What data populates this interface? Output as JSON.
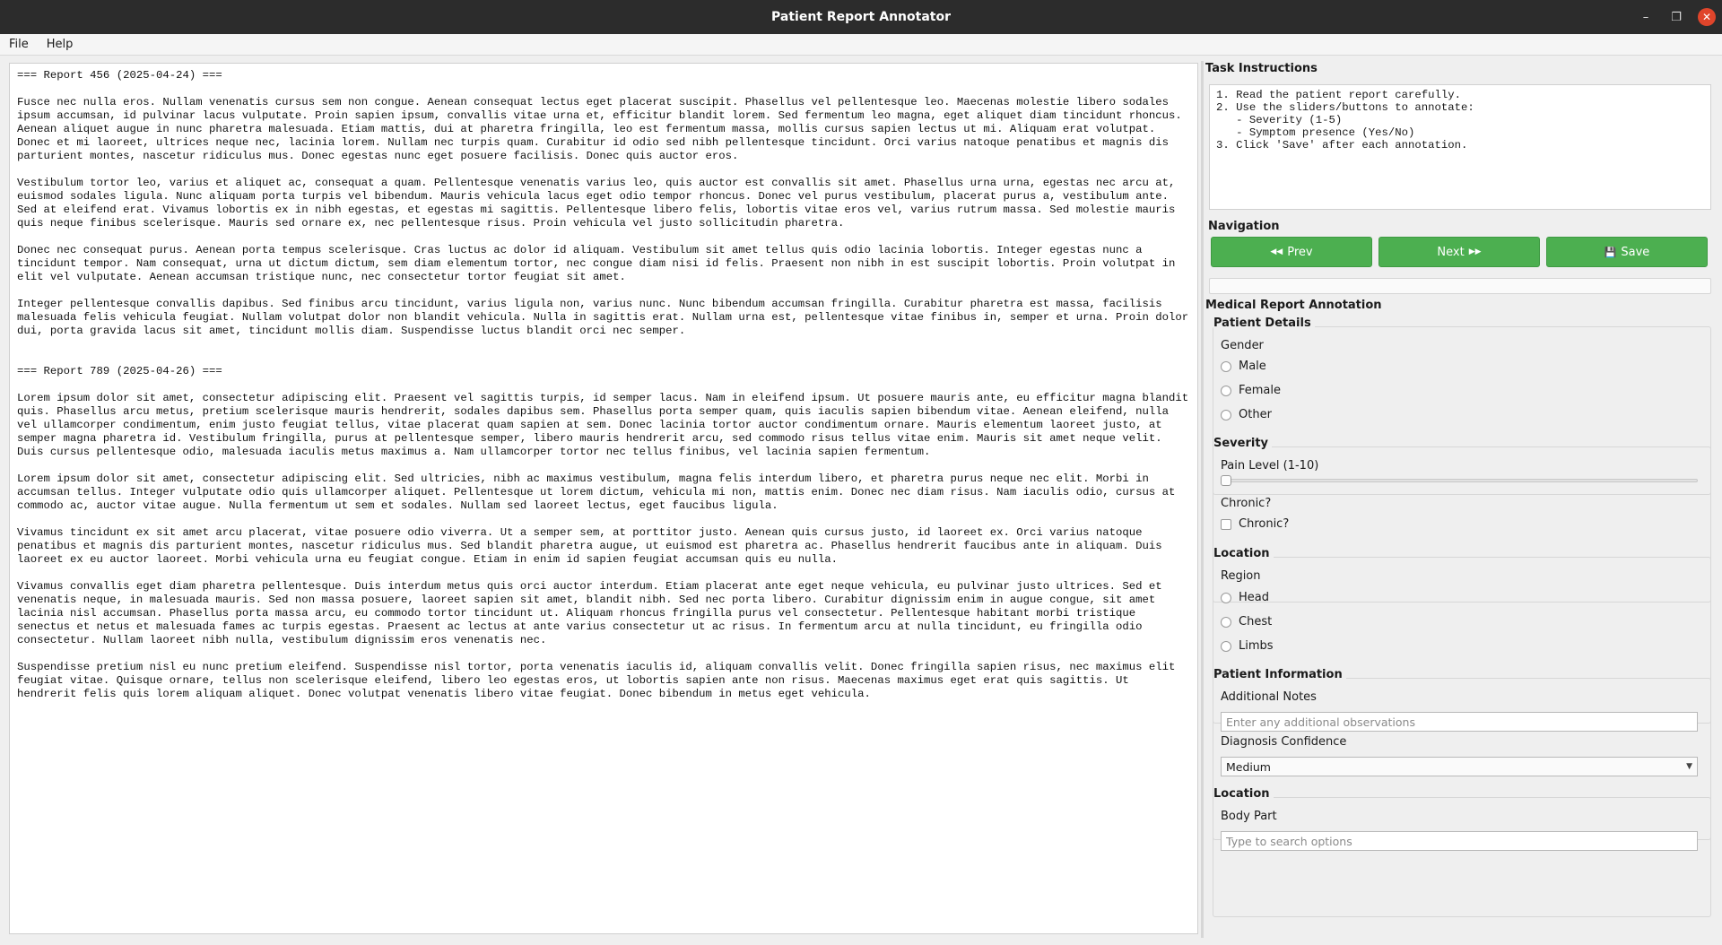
{
  "window": {
    "title": "Patient Report Annotator"
  },
  "menu": {
    "file": "File",
    "help": "Help"
  },
  "report": {
    "text": "=== Report 456 (2025-04-24) ===\n\nFusce nec nulla eros. Nullam venenatis cursus sem non congue. Aenean consequat lectus eget placerat suscipit. Phasellus vel pellentesque leo. Maecenas molestie libero sodales ipsum accumsan, id pulvinar lacus vulputate. Proin sapien ipsum, convallis vitae urna et, efficitur blandit lorem. Sed fermentum leo magna, eget aliquet diam tincidunt rhoncus. Aenean aliquet augue in nunc pharetra malesuada. Etiam mattis, dui at pharetra fringilla, leo est fermentum massa, mollis cursus sapien lectus ut mi. Aliquam erat volutpat. Donec et mi laoreet, ultrices neque nec, lacinia lorem. Nullam nec turpis quam. Curabitur id odio sed nibh pellentesque tincidunt. Orci varius natoque penatibus et magnis dis parturient montes, nascetur ridiculus mus. Donec egestas nunc eget posuere facilisis. Donec quis auctor eros.\n\nVestibulum tortor leo, varius et aliquet ac, consequat a quam. Pellentesque venenatis varius leo, quis auctor est convallis sit amet. Phasellus urna urna, egestas nec arcu at, euismod sodales ligula. Nunc aliquam porta turpis vel bibendum. Mauris vehicula lacus eget odio tempor rhoncus. Donec vel purus vestibulum, placerat purus a, vestibulum ante. Sed at eleifend erat. Vivamus lobortis ex in nibh egestas, et egestas mi sagittis. Pellentesque libero felis, lobortis vitae eros vel, varius rutrum massa. Sed molestie mauris quis neque finibus scelerisque. Mauris sed ornare ex, nec pellentesque risus. Proin vehicula vel justo sollicitudin pharetra.\n\nDonec nec consequat purus. Aenean porta tempus scelerisque. Cras luctus ac dolor id aliquam. Vestibulum sit amet tellus quis odio lacinia lobortis. Integer egestas nunc a tincidunt tempor. Nam consequat, urna ut dictum dictum, sem diam elementum tortor, nec congue diam nisi id felis. Praesent non nibh in est suscipit lobortis. Proin volutpat in elit vel vulputate. Aenean accumsan tristique nunc, nec consectetur tortor feugiat sit amet.\n\nInteger pellentesque convallis dapibus. Sed finibus arcu tincidunt, varius ligula non, varius nunc. Nunc bibendum accumsan fringilla. Curabitur pharetra est massa, facilisis malesuada felis vehicula feugiat. Nullam volutpat dolor non blandit vehicula. Nulla in sagittis erat. Nullam urna est, pellentesque vitae finibus in, semper et urna. Proin dolor dui, porta gravida lacus sit amet, tincidunt mollis diam. Suspendisse luctus blandit orci nec semper.\n\n\n=== Report 789 (2025-04-26) ===\n\nLorem ipsum dolor sit amet, consectetur adipiscing elit. Praesent vel sagittis turpis, id semper lacus. Nam in eleifend ipsum. Ut posuere mauris ante, eu efficitur magna blandit quis. Phasellus arcu metus, pretium scelerisque mauris hendrerit, sodales dapibus sem. Phasellus porta semper quam, quis iaculis sapien bibendum vitae. Aenean eleifend, nulla vel ullamcorper condimentum, enim justo feugiat tellus, vitae placerat quam sapien at sem. Donec lacinia tortor auctor condimentum ornare. Mauris elementum laoreet justo, at semper magna pharetra id. Vestibulum fringilla, purus at pellentesque semper, libero mauris hendrerit arcu, sed commodo risus tellus vitae enim. Mauris sit amet neque velit. Duis cursus pellentesque odio, malesuada iaculis metus maximus a. Nam ullamcorper tortor nec tellus finibus, vel lacinia sapien fermentum.\n\nLorem ipsum dolor sit amet, consectetur adipiscing elit. Sed ultricies, nibh ac maximus vestibulum, magna felis interdum libero, et pharetra purus neque nec elit. Morbi in accumsan tellus. Integer vulputate odio quis ullamcorper aliquet. Pellentesque ut lorem dictum, vehicula mi non, mattis enim. Donec nec diam risus. Nam iaculis odio, cursus at commodo ac, auctor vitae augue. Nulla fermentum ut sem et sodales. Nullam sed laoreet lectus, eget faucibus ligula.\n\nVivamus tincidunt ex sit amet arcu placerat, vitae posuere odio viverra. Ut a semper sem, at porttitor justo. Aenean quis cursus justo, id laoreet ex. Orci varius natoque penatibus et magnis dis parturient montes, nascetur ridiculus mus. Sed blandit pharetra augue, ut euismod est pharetra ac. Phasellus hendrerit faucibus ante in aliquam. Duis laoreet ex eu auctor laoreet. Morbi vehicula urna eu feugiat congue. Etiam in enim id sapien feugiat accumsan quis eu nulla.\n\nVivamus convallis eget diam pharetra pellentesque. Duis interdum metus quis orci auctor interdum. Etiam placerat ante eget neque vehicula, eu pulvinar justo ultrices. Sed et venenatis neque, in malesuada mauris. Sed non massa posuere, laoreet sapien sit amet, blandit nibh. Sed nec porta libero. Curabitur dignissim enim in augue congue, sit amet lacinia nisl accumsan. Phasellus porta massa arcu, eu commodo tortor tincidunt ut. Aliquam rhoncus fringilla purus vel consectetur. Pellentesque habitant morbi tristique senectus et netus et malesuada fames ac turpis egestas. Praesent ac lectus at ante varius consectetur ut ac risus. In fermentum arcu at nulla tincidunt, eu fringilla odio consectetur. Nullam laoreet nibh nulla, vestibulum dignissim eros venenatis nec.\n\nSuspendisse pretium nisl eu nunc pretium eleifend. Suspendisse nisl tortor, porta venenatis iaculis id, aliquam convallis velit. Donec fringilla sapien risus, nec maximus elit feugiat vitae. Quisque ornare, tellus non scelerisque eleifend, libero leo egestas eros, ut lobortis sapien ante non risus. Maecenas maximus eget erat quis sagittis. Ut hendrerit felis quis lorem aliquam aliquet. Donec volutpat venenatis libero vitae feugiat. Donec bibendum in metus eget vehicula."
  },
  "instructions": {
    "title": "Task Instructions",
    "text": "1. Read the patient report carefully.\n2. Use the sliders/buttons to annotate:\n   - Severity (1-5)\n   - Symptom presence (Yes/No)\n3. Click 'Save' after each annotation."
  },
  "navigation": {
    "title": "Navigation",
    "prev_label": "Prev",
    "next_label": "Next",
    "save_label": "Save",
    "button_color": "#4caf50"
  },
  "annotation": {
    "title": "Medical Report Annotation",
    "patient_details": {
      "title": "Patient Details",
      "gender_label": "Gender",
      "options": [
        "Male",
        "Female",
        "Other"
      ]
    },
    "severity": {
      "title": "Severity",
      "pain_label": "Pain Level (1-10)",
      "pain_value": 1,
      "pain_min": 1,
      "pain_max": 10,
      "chronic_label": "Chronic?",
      "chronic_checkbox_label": "Chronic?",
      "chronic_checked": false
    },
    "location": {
      "title": "Location",
      "region_label": "Region",
      "options": [
        "Head",
        "Chest",
        "Limbs"
      ]
    },
    "patient_information": {
      "title": "Patient Information",
      "notes_label": "Additional Notes",
      "notes_placeholder": "Enter any additional observations",
      "confidence_label": "Diagnosis Confidence",
      "confidence_value": "Medium"
    },
    "location2": {
      "title": "Location",
      "body_part_label": "Body Part",
      "body_part_placeholder": "Type to search options"
    }
  }
}
